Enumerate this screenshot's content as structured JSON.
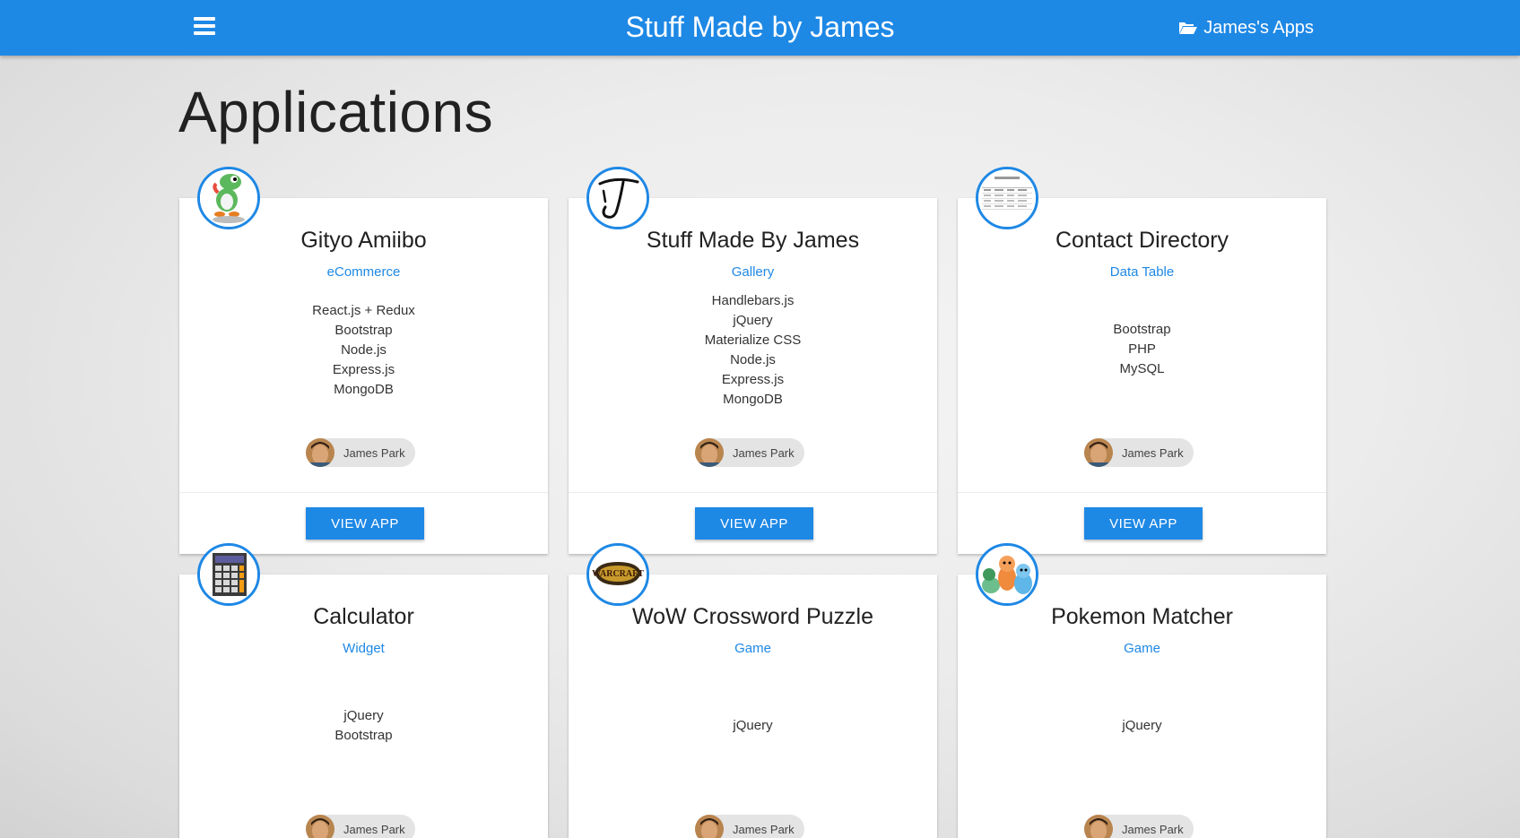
{
  "navbar": {
    "brand": "Stuff Made by James",
    "apps_link": "James's Apps",
    "menu_icon": "hamburger-menu-icon",
    "apps_icon": "folder-open-icon",
    "color": "#1e88e5"
  },
  "page": {
    "title": "Applications"
  },
  "cards": [
    {
      "title": "Gityo Amiibo",
      "category": "eCommerce",
      "tech": [
        "React.js + Redux",
        "Bootstrap",
        "Node.js",
        "Express.js",
        "MongoDB"
      ],
      "author": "James Park",
      "button": "VIEW APP",
      "icon": "yoshi-amiibo-thumbnail"
    },
    {
      "title": "Stuff Made By James",
      "category": "Gallery",
      "tech": [
        "Handlebars.js",
        "jQuery",
        "Materialize CSS",
        "Node.js",
        "Express.js",
        "MongoDB"
      ],
      "author": "James Park",
      "button": "VIEW APP",
      "icon": "j-logo-thumbnail"
    },
    {
      "title": "Contact Directory",
      "category": "Data Table",
      "tech": [
        "Bootstrap",
        "PHP",
        "MySQL"
      ],
      "author": "James Park",
      "button": "VIEW APP",
      "icon": "data-table-thumbnail"
    },
    {
      "title": "Calculator",
      "category": "Widget",
      "tech": [
        "jQuery",
        "Bootstrap"
      ],
      "author": "James Park",
      "icon": "calculator-thumbnail"
    },
    {
      "title": "WoW Crossword Puzzle",
      "category": "Game",
      "tech": [
        "jQuery"
      ],
      "author": "James Park",
      "icon": "warcraft-logo-thumbnail",
      "icon_text": "WARCRAFT"
    },
    {
      "title": "Pokemon Matcher",
      "category": "Game",
      "tech": [
        "jQuery"
      ],
      "author": "James Park",
      "icon": "pokemon-starters-thumbnail"
    }
  ]
}
